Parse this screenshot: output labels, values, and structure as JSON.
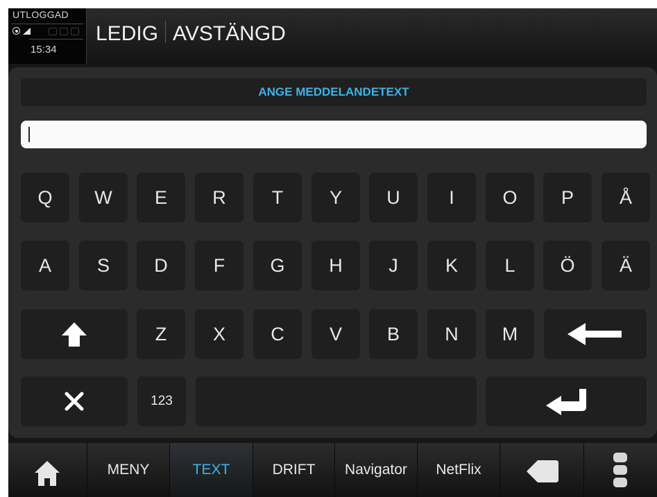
{
  "status": {
    "login_state": "UTLOGGAD",
    "time": "15:34",
    "icons": [
      "gps-icon",
      "signal-icon",
      "lock-icon",
      "phone-icon",
      "message-icon"
    ]
  },
  "header": {
    "state_left": "LEDIG",
    "state_right": "AVSTÄNGD"
  },
  "prompt": "ANGE MEDDELANDETEXT",
  "text_input": {
    "value": ""
  },
  "keyboard": {
    "row1": [
      "Q",
      "W",
      "E",
      "R",
      "T",
      "Y",
      "U",
      "I",
      "O",
      "P",
      "Å"
    ],
    "row2": [
      "A",
      "S",
      "D",
      "F",
      "G",
      "H",
      "J",
      "K",
      "L",
      "Ö",
      "Ä"
    ],
    "row3": [
      "Z",
      "X",
      "C",
      "V",
      "B",
      "N",
      "M"
    ],
    "numbers_label": "123",
    "special_keys": [
      "shift-up-arrow-icon",
      "backspace-left-arrow-icon",
      "close-x-icon",
      "enter-return-icon"
    ]
  },
  "nav": {
    "items": [
      "MENY",
      "TEXT",
      "DRIFT",
      "Navigator",
      "NetFlix"
    ],
    "active": "TEXT",
    "icons": [
      "home-icon",
      "back-icon",
      "more-icon"
    ]
  },
  "colors": {
    "accent": "#3db3e6",
    "key_bg": "#1f1f1f",
    "panel_bg": "#2b2b2b",
    "text": "#e8e8e8"
  }
}
